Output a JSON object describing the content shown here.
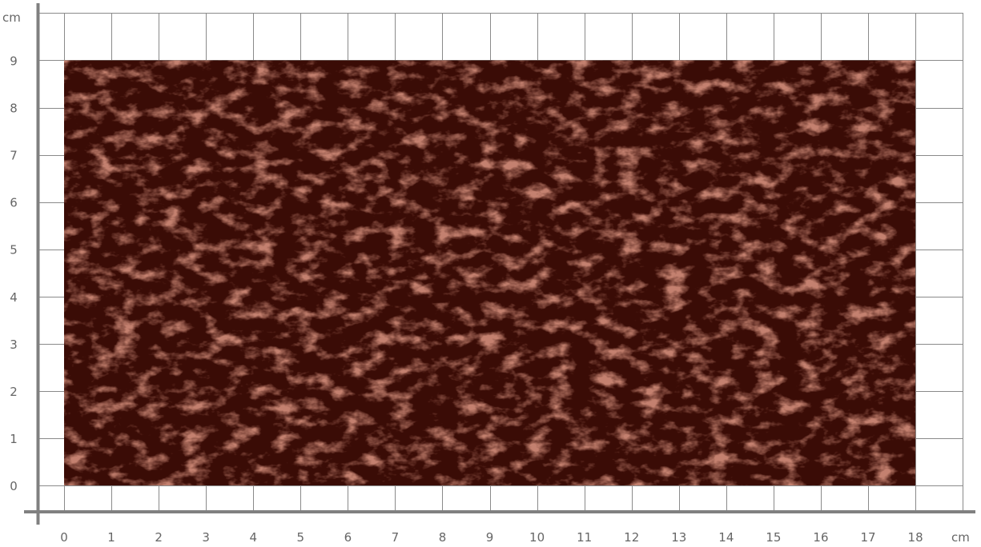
{
  "unit_label_y": "cm",
  "unit_label_x": "cm",
  "x_ticks": [
    "0",
    "1",
    "2",
    "3",
    "4",
    "5",
    "6",
    "7",
    "8",
    "9",
    "10",
    "11",
    "12",
    "13",
    "14",
    "15",
    "16",
    "17",
    "18"
  ],
  "y_ticks": [
    "0",
    "1",
    "2",
    "3",
    "4",
    "5",
    "6",
    "7",
    "8",
    "9"
  ],
  "swatch": {
    "width_cm": 18,
    "height_cm": 9,
    "color": "#3a0c06"
  },
  "colors": {
    "grid": "#8a8a8a",
    "axis": "#808080",
    "label": "#666666"
  }
}
